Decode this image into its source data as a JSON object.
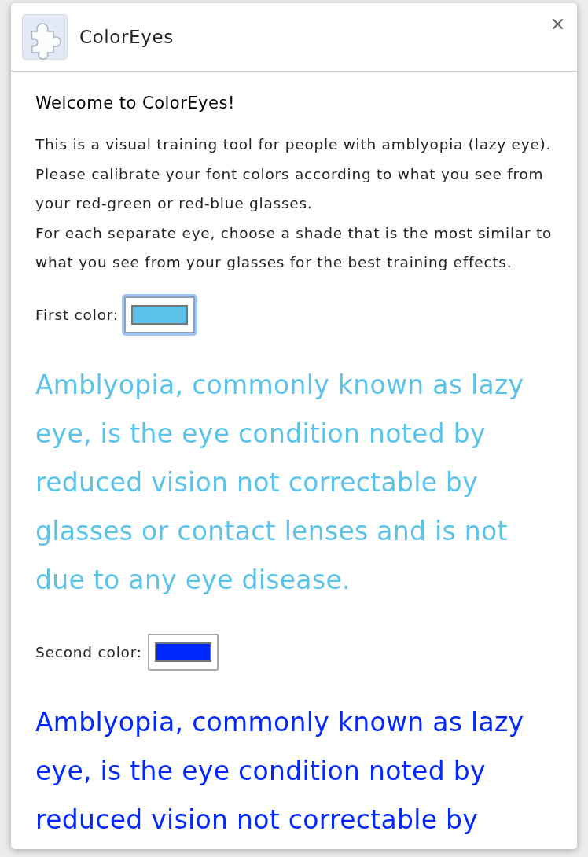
{
  "header": {
    "title": "ColorEyes"
  },
  "welcome": {
    "heading": "Welcome to ColorEyes!",
    "paragraphs": [
      "This is a visual training tool for people with amblyopia (lazy eye).",
      "Please calibrate your font colors according to what you see from your red-green or red-blue glasses.",
      "For each separate eye, choose a shade that is the most similar to what you see from your glasses for the best training effects."
    ]
  },
  "colors": [
    {
      "label": "First color:",
      "color": "#5bc2ea",
      "focused": true,
      "sample_text": "Amblyopia, commonly known as lazy eye, is the eye condition noted by reduced vision not correctable by glasses or contact lenses and is not due to any eye disease."
    },
    {
      "label": "Second color:",
      "color": "#0028ff",
      "focused": false,
      "sample_text": "Amblyopia, commonly known as lazy eye, is the eye condition noted by reduced vision not correctable by"
    }
  ]
}
